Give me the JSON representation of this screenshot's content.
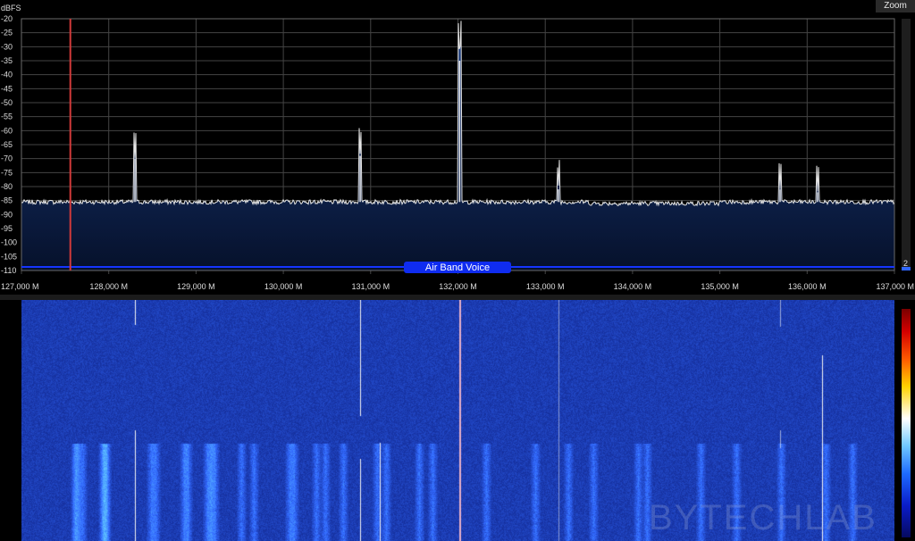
{
  "spectrum": {
    "unit_label": "dBFS",
    "y_ticks": [
      "-20",
      "-25",
      "-30",
      "-35",
      "-40",
      "-45",
      "-50",
      "-55",
      "-60",
      "-65",
      "-70",
      "-75",
      "-80",
      "-85",
      "-90",
      "-95",
      "-100",
      "-105",
      "-110"
    ],
    "x_ticks": [
      "127,000 M",
      "128,000 M",
      "129,000 M",
      "130,000 M",
      "131,000 M",
      "132,000 M",
      "133,000 M",
      "134,000 M",
      "135,000 M",
      "136,000 M",
      "137,000 M"
    ],
    "band_label": "Air Band Voice",
    "noise_floor_dbfs": -85.5,
    "peaks": [
      {
        "freq_khz": 128300,
        "dbfs": -70
      },
      {
        "freq_khz": 130880,
        "dbfs": -69
      },
      {
        "freq_khz": 132020,
        "dbfs": -35
      },
      {
        "freq_khz": 133150,
        "dbfs": -81
      },
      {
        "freq_khz": 135690,
        "dbfs": -81
      },
      {
        "freq_khz": 136120,
        "dbfs": -82
      }
    ],
    "tuned_freq_khz": 127560,
    "range_khz": [
      127000,
      137000
    ],
    "range_dbfs": [
      -110,
      -20
    ],
    "colors": {
      "trace": "#e8e8e8",
      "fill_top": "#1a3a7a",
      "fill_bottom": "#07142e",
      "grid": "#4a4a4a",
      "marker": "#d23a3a",
      "band": "#1535ff"
    }
  },
  "controls": {
    "zoom_label": "Zoom",
    "gain_value": "2"
  },
  "waterfall": {
    "carriers_khz": [
      128300,
      130880,
      131100,
      132020,
      133150,
      135690,
      136120
    ],
    "colors": {
      "background": "#0b1d8a",
      "carrier": "#ffffff"
    }
  },
  "watermark": "BYTECHLAB"
}
